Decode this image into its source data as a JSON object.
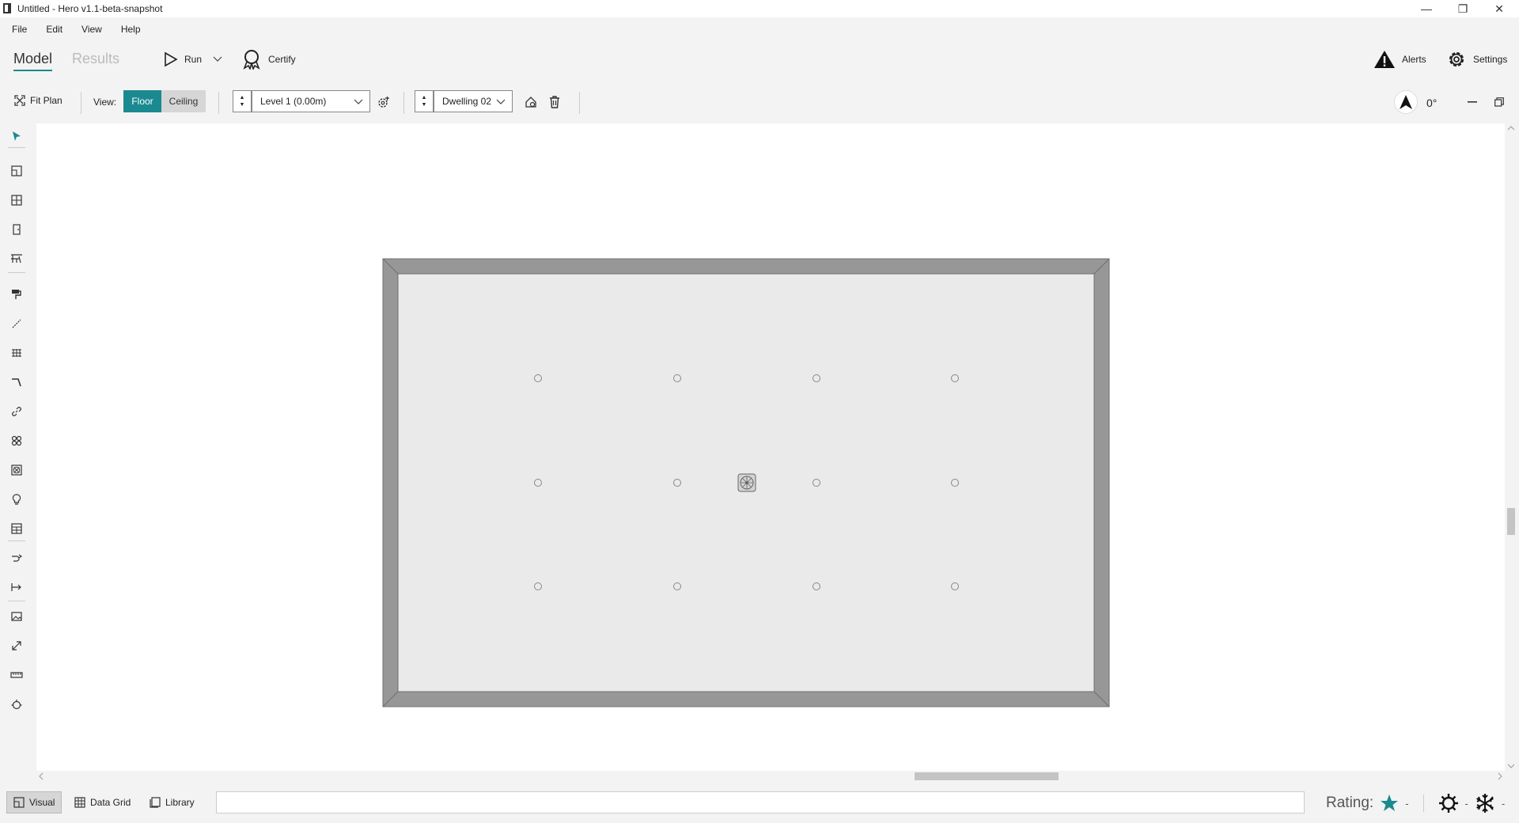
{
  "window": {
    "title": "Untitled - Hero v1.1-beta-snapshot",
    "minimize_glyph": "—",
    "restore_glyph": "❐",
    "close_glyph": "✕"
  },
  "menu": [
    "File",
    "Edit",
    "View",
    "Help"
  ],
  "tabs": {
    "model": "Model",
    "results": "Results"
  },
  "actions": {
    "run": "Run",
    "certify": "Certify",
    "alerts": "Alerts",
    "settings": "Settings"
  },
  "toolbar": {
    "fit_plan": "Fit Plan",
    "view_label": "View:",
    "floor": "Floor",
    "ceiling": "Ceiling",
    "level": "Level 1 (0.00m)",
    "dwelling": "Dwelling 02",
    "rotation": "0°"
  },
  "status": {
    "visual": "Visual",
    "data_grid": "Data Grid",
    "library": "Library",
    "rating_label": "Rating:",
    "rating_value": "-",
    "heating_value": "-",
    "cooling_value": "-"
  },
  "colors": {
    "accent": "#1a8a90",
    "wall": "#979797",
    "floor": "#eaeaea",
    "star": "#1a8a90"
  }
}
